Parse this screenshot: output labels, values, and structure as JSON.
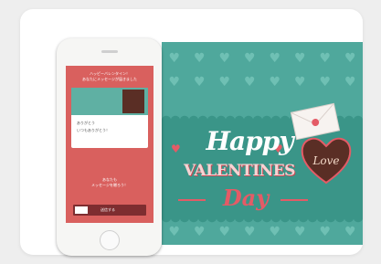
{
  "banner": {
    "heart_glyph": "♥",
    "happy_text": "Happy",
    "valentines_text": "VALENTINES",
    "day_text": "Day",
    "love_text": "Love",
    "colors": {
      "teal": "#4fa89c",
      "band": "#3a9588",
      "red": "#e45b66",
      "chocolate": "#5a2e25"
    }
  },
  "phone_screen": {
    "header_line1": "ハッピーバレンタイン！",
    "header_line2": "あなたにメッセージが届きました",
    "message_line1": "ありがとう",
    "message_line2": "いつもありがとう！",
    "footer_line1": "あなたも",
    "footer_line2": "メッセージを贈ろう！",
    "send_label": "送信する"
  }
}
